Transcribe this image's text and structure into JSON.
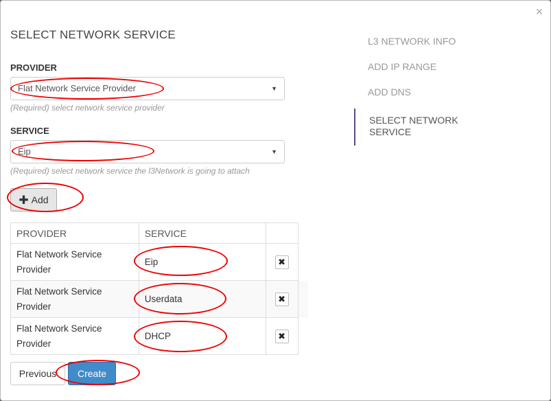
{
  "dialog": {
    "title": "SELECT NETWORK SERVICE",
    "close_glyph": "×"
  },
  "provider": {
    "label": "PROVIDER",
    "selected": "Flat Network Service Provider",
    "help": "(Required) select network service provider"
  },
  "service": {
    "label": "SERVICE",
    "selected": "Eip",
    "help": "(Required) select network service the l3Network is going to attach"
  },
  "add_button": {
    "label": "Add",
    "icon": "plus-icon"
  },
  "table": {
    "headers": [
      "PROVIDER",
      "SERVICE"
    ],
    "rows": [
      {
        "provider": "Flat Network Service Provider",
        "service": "Eip"
      },
      {
        "provider": "Flat Network Service Provider",
        "service": "Userdata"
      },
      {
        "provider": "Flat Network Service Provider",
        "service": "DHCP"
      }
    ],
    "remove_glyph": "✖"
  },
  "footer": {
    "previous_label": "Previous",
    "create_label": "Create"
  },
  "steps": [
    {
      "label": "L3 NETWORK INFO",
      "active": false
    },
    {
      "label": "ADD IP RANGE",
      "active": false
    },
    {
      "label": "ADD DNS",
      "active": false
    },
    {
      "label": "SELECT NETWORK SERVICE",
      "active": true
    }
  ],
  "colors": {
    "primary": "#428bca",
    "annotation": "#e00000",
    "active_step_border": "#5a4a7a"
  }
}
